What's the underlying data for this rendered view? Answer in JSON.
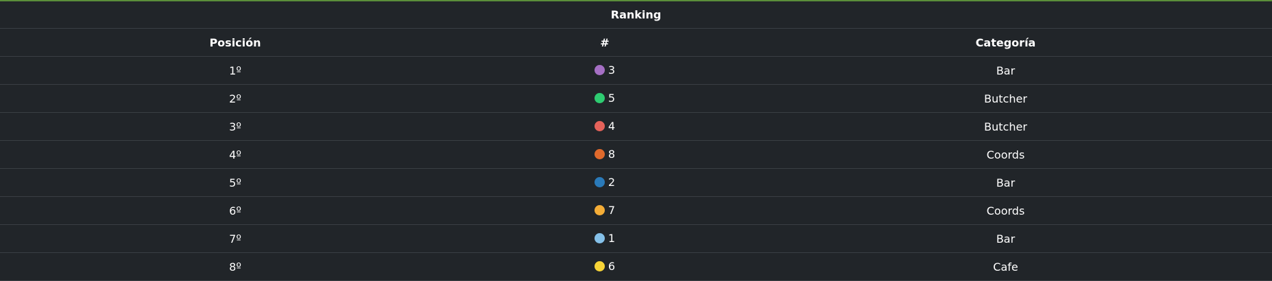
{
  "table": {
    "title": "Ranking",
    "headers": {
      "position": "Posición",
      "number": "#",
      "category": "Categoría"
    },
    "rows": [
      {
        "position": "1º",
        "number": "3",
        "color": "#a56fc4",
        "category": "Bar"
      },
      {
        "position": "2º",
        "number": "5",
        "color": "#2ecc71",
        "category": "Butcher"
      },
      {
        "position": "3º",
        "number": "4",
        "color": "#e5625a",
        "category": "Butcher"
      },
      {
        "position": "4º",
        "number": "8",
        "color": "#e06a2c",
        "category": "Coords"
      },
      {
        "position": "5º",
        "number": "2",
        "color": "#2a7ab9",
        "category": "Bar"
      },
      {
        "position": "6º",
        "number": "7",
        "color": "#f4ad37",
        "category": "Coords"
      },
      {
        "position": "7º",
        "number": "1",
        "color": "#85c1e9",
        "category": "Bar"
      },
      {
        "position": "8º",
        "number": "6",
        "color": "#f7d437",
        "category": "Cafe"
      }
    ]
  },
  "colors": {
    "background": "#212529",
    "accent": "#5b8f3a",
    "divider": "#3a3f44"
  }
}
